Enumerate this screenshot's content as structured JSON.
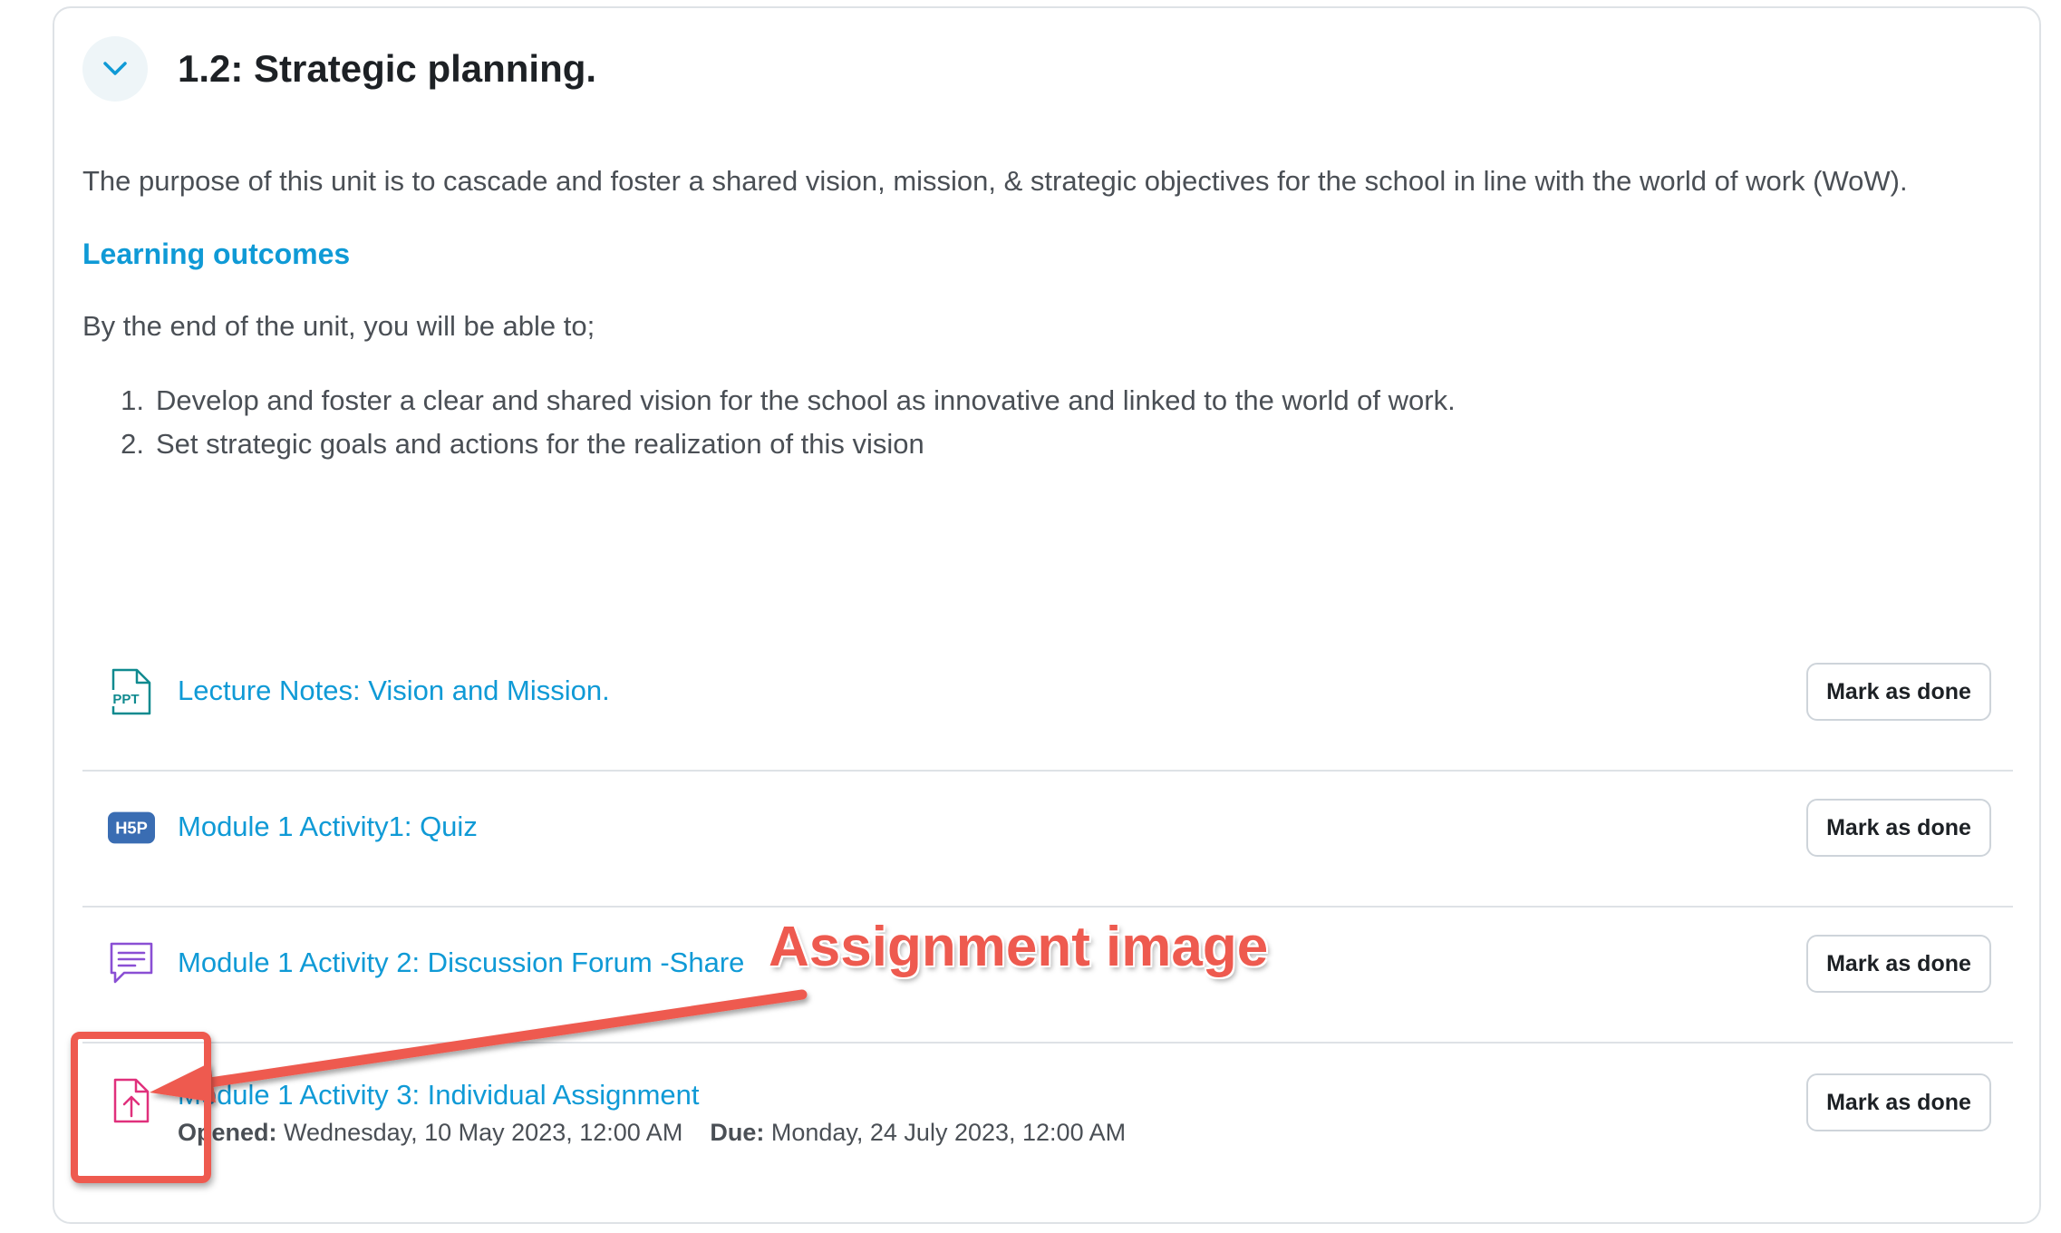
{
  "section": {
    "title": "1.2: Strategic planning.",
    "summary": "The purpose of this unit is to cascade and foster a shared vision, mission, & strategic objectives for the school in line with the world of work (WoW).",
    "outcomes_heading": "Learning outcomes",
    "intro": "By the end of the unit, you will be able to;",
    "outcomes": [
      {
        "num": "1.",
        "text": "Develop and foster a clear and shared vision for the school as innovative and linked to the world of work."
      },
      {
        "num": "2.",
        "text": "Set strategic goals and actions for the realization of this vision"
      }
    ]
  },
  "activities": [
    {
      "icon": "ppt-file-icon",
      "icon_text": "PPT",
      "title": "Lecture Notes: Vision and Mission.",
      "button": "Mark as done"
    },
    {
      "icon": "h5p-icon",
      "icon_text": "H5P",
      "title": "Module 1 Activity1: Quiz",
      "button": "Mark as done"
    },
    {
      "icon": "forum-icon",
      "title": "Module 1 Activity 2: Discussion Forum -Share",
      "button": "Mark as done"
    },
    {
      "icon": "assignment-upload-icon",
      "title": "Module 1 Activity 3: Individual Assignment",
      "button": "Mark as done",
      "opened_label": "Opened:",
      "opened_value": "Wednesday, 10 May 2023, 12:00 AM",
      "due_label": "Due:",
      "due_value": "Monday, 24 July 2023, 12:00 AM"
    }
  ],
  "annotation": {
    "label": "Assignment image",
    "color": "#ee5a4f"
  },
  "colors": {
    "link": "#0f9ad6",
    "ppt_icon": "#0f8a8f",
    "h5p_icon": "#3a6db3",
    "forum_icon": "#8a4fd4",
    "assignment_icon": "#e0307c"
  }
}
